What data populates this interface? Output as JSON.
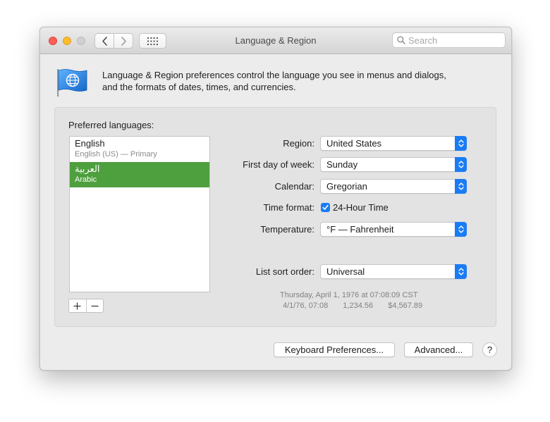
{
  "window": {
    "title": "Language & Region",
    "search_placeholder": "Search"
  },
  "description": {
    "line1": "Language & Region preferences control the language you see in menus and dialogs,",
    "line2": "and the formats of dates, times, and currencies."
  },
  "languages": {
    "label": "Preferred languages:",
    "items": [
      {
        "name": "English",
        "subtitle": "English (US) — Primary",
        "selected": false
      },
      {
        "name": "العربية",
        "subtitle": "Arabic",
        "selected": true
      }
    ],
    "add_label": "+",
    "remove_label": "−"
  },
  "settings": {
    "region": {
      "label": "Region:",
      "value": "United States"
    },
    "first_day": {
      "label": "First day of week:",
      "value": "Sunday"
    },
    "calendar": {
      "label": "Calendar:",
      "value": "Gregorian"
    },
    "time_format": {
      "label": "Time format:",
      "checkbox_label": "24-Hour Time",
      "checked": true
    },
    "temperature": {
      "label": "Temperature:",
      "value": "°F — Fahrenheit"
    },
    "sort_order": {
      "label": "List sort order:",
      "value": "Universal"
    }
  },
  "sample": {
    "date_line": "Thursday, April 1, 1976 at 07:08:09 CST",
    "short_date": "4/1/76, 07:08",
    "number": "1,234.56",
    "currency": "$4,567.89"
  },
  "buttons": {
    "keyboard": "Keyboard Preferences...",
    "advanced": "Advanced...",
    "help": "?"
  },
  "colors": {
    "accent": "#1a7cf5",
    "selection": "#4e9f3d",
    "close": "#fc5f57",
    "minimize": "#fdbc2e"
  }
}
